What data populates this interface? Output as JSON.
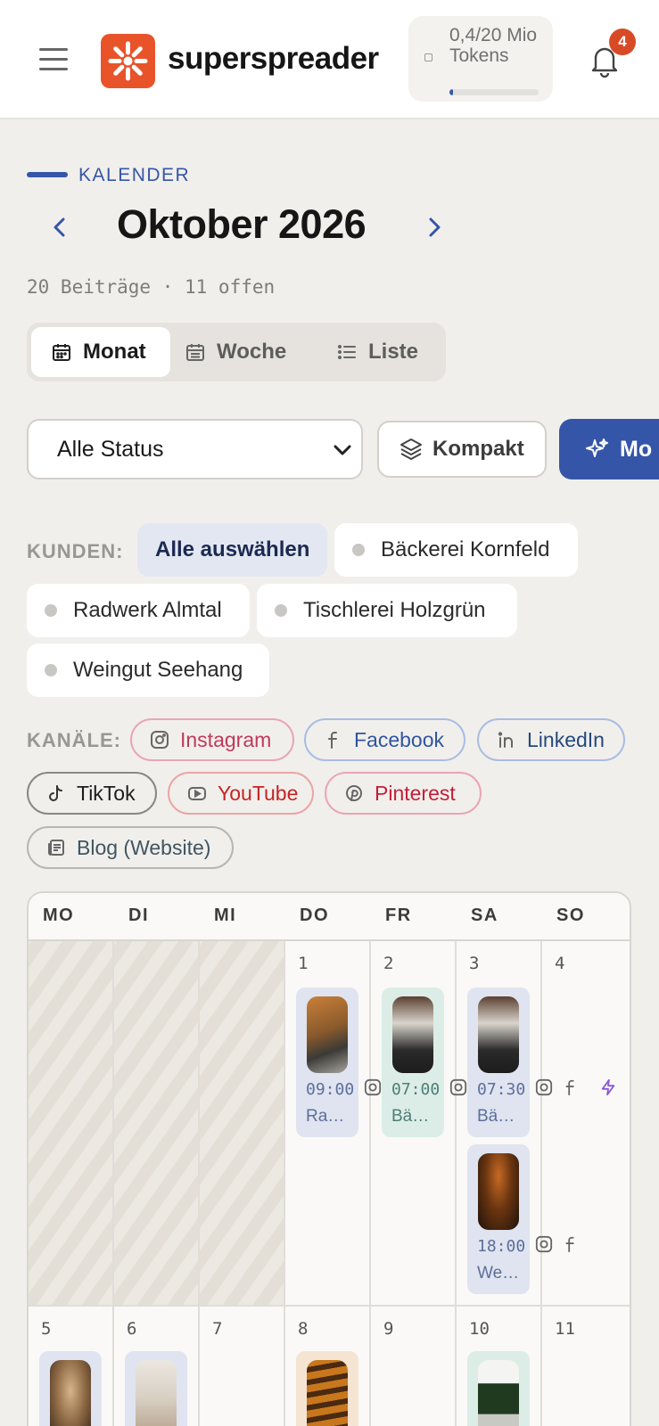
{
  "header": {
    "brand": "superspreader",
    "tokens_text": "0,4/20 Mio Tokens",
    "tokens_progress": 0.02,
    "notification_count": "4"
  },
  "page": {
    "kicker": "KALENDER",
    "month_title": "Oktober 2026",
    "subcount": "20 Beiträge · 11 offen"
  },
  "view_tabs": [
    {
      "label": "Monat",
      "active": true
    },
    {
      "label": "Woche",
      "active": false
    },
    {
      "label": "Liste",
      "active": false
    }
  ],
  "filters": {
    "status_value": "Alle Status",
    "kompakt_label": "Kompakt",
    "more_label": "Mo"
  },
  "kunden": {
    "label": "KUNDEN:",
    "select_all": "Alle auswählen",
    "clients": [
      "Bäckerei Kornfeld",
      "Radwerk Almtal",
      "Tischlerei Holzgrün",
      "Weingut Seehang"
    ]
  },
  "kanaele": {
    "label": "KANÄLE:",
    "channels": [
      {
        "label": "Instagram",
        "color": "#c0395a",
        "border": "#e7a6b6"
      },
      {
        "label": "Facebook",
        "color": "#2f55a0",
        "border": "#a9bde2"
      },
      {
        "label": "LinkedIn",
        "color": "#24497e",
        "border": "#a9bde2"
      },
      {
        "label": "TikTok",
        "color": "#1c1c1c",
        "border": "#8a8885"
      },
      {
        "label": "YouTube",
        "color": "#c62424",
        "border": "#eba5a5"
      },
      {
        "label": "Pinterest",
        "color": "#c21f3a",
        "border": "#eba5b1"
      },
      {
        "label": "Blog (Website)",
        "color": "#3f5560",
        "border": "#b7b6b2"
      }
    ]
  },
  "calendar": {
    "weekdays": [
      "MO",
      "DI",
      "MI",
      "DO",
      "FR",
      "SA",
      "SO"
    ],
    "week1_days": [
      "",
      "",
      "",
      "1",
      "2",
      "3",
      "4"
    ],
    "week2_days": [
      "5",
      "6",
      "7",
      "8",
      "9",
      "10",
      "11"
    ],
    "posts": [
      {
        "time": "09:00",
        "title": "Ra…"
      },
      {
        "time": "07:00",
        "title": "Bä…"
      },
      {
        "time": "07:30",
        "title": "Bä…"
      },
      {
        "time": "18:00",
        "title": "We…"
      }
    ]
  }
}
